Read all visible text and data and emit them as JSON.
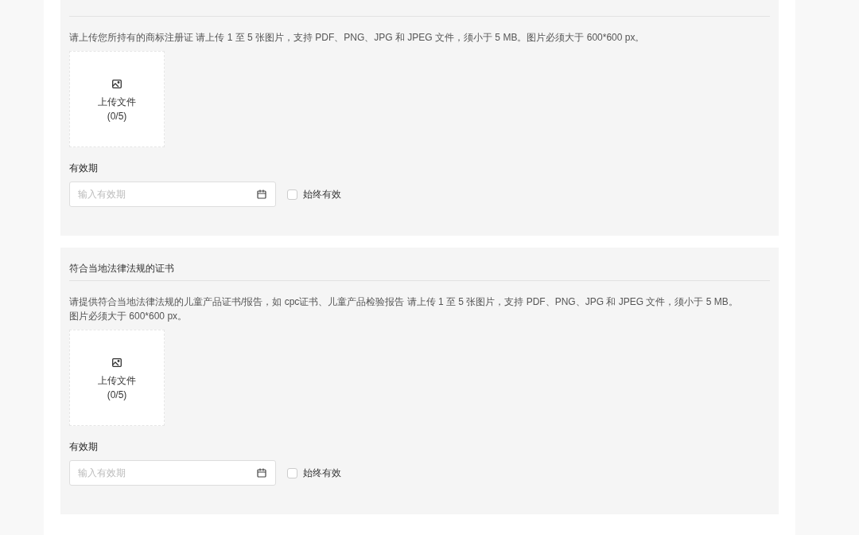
{
  "sections": [
    {
      "description": "请上传您所持有的商标注册证 请上传 1 至 5 张图片，支持 PDF、PNG、JPG 和 JPEG 文件，须小于 5 MB。图片必须大于 600*600 px。",
      "upload": {
        "label": "上传文件",
        "count": "(0/5)"
      },
      "validity": {
        "label": "有效期",
        "placeholder": "输入有效期"
      },
      "always_valid": {
        "label": "始终有效",
        "checked": false
      }
    },
    {
      "title": "符合当地法律法规的证书",
      "description": "请提供符合当地法律法规的儿童产品证书/报告，如 cpc证书、儿童产品检验报告 请上传 1 至 5 张图片，支持 PDF、PNG、JPG 和 JPEG 文件，须小于 5 MB。图片必须大于 600*600 px。",
      "upload": {
        "label": "上传文件",
        "count": "(0/5)"
      },
      "validity": {
        "label": "有效期",
        "placeholder": "输入有效期"
      },
      "always_valid": {
        "label": "始终有效",
        "checked": false
      }
    }
  ]
}
